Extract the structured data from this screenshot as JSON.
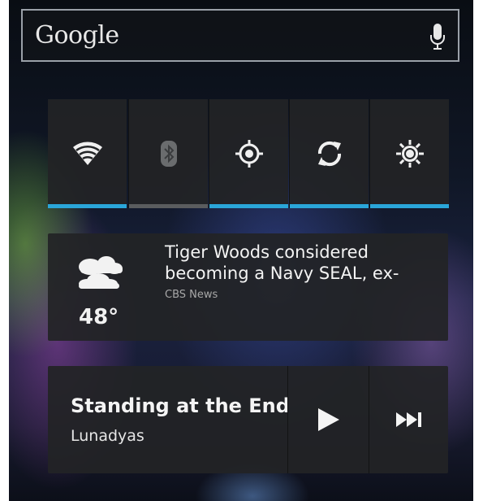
{
  "search": {
    "logo": "Google",
    "mic_icon": "microphone-icon"
  },
  "quick_settings": {
    "accent": "#2aa6d9",
    "tiles": [
      {
        "name": "wifi",
        "icon": "wifi-icon",
        "enabled": true
      },
      {
        "name": "bluetooth",
        "icon": "bluetooth-icon",
        "enabled": false
      },
      {
        "name": "location",
        "icon": "location-icon",
        "enabled": true
      },
      {
        "name": "sync",
        "icon": "sync-icon",
        "enabled": true
      },
      {
        "name": "brightness",
        "icon": "brightness-icon",
        "enabled": true
      }
    ]
  },
  "news": {
    "weather_icon": "partly-cloudy-icon",
    "temperature": "48°",
    "headline": "Tiger Woods considered becoming a Navy SEAL, ex-",
    "source": "CBS News"
  },
  "music": {
    "title": "Standing at the End",
    "artist": "Lunadyas",
    "play_icon": "play-icon",
    "next_icon": "skip-next-icon"
  }
}
